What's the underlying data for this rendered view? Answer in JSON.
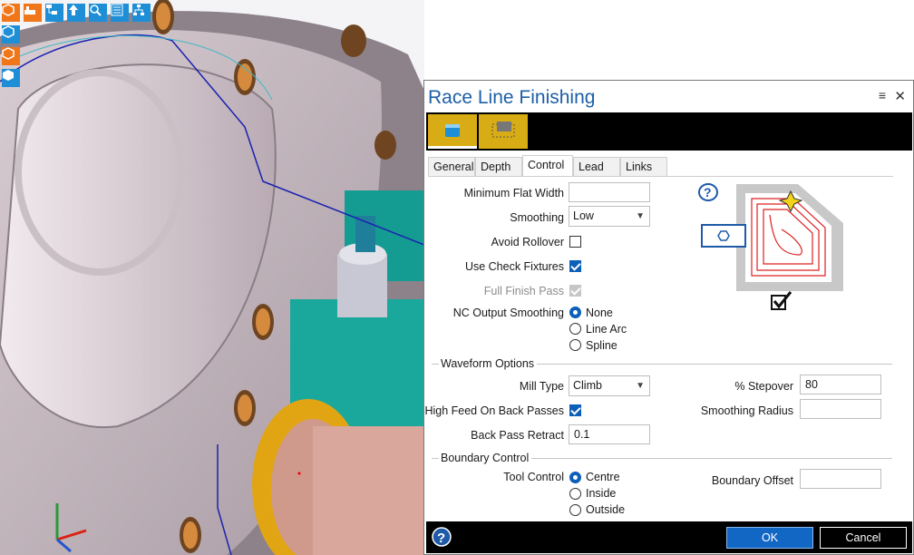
{
  "dialog": {
    "title": "Race Line Finishing",
    "menu_icon": "hamburger-icon",
    "close_icon": "close-icon"
  },
  "tabs": [
    "General",
    "Depth",
    "Control",
    "Lead",
    "Links"
  ],
  "active_tab": "Control",
  "control": {
    "min_flat_width_label": "Minimum Flat Width",
    "min_flat_width_value": "",
    "smoothing_label": "Smoothing",
    "smoothing_value": "Low",
    "avoid_rollover_label": "Avoid Rollover",
    "use_check_fixtures_label": "Use Check Fixtures",
    "full_finish_pass_label": "Full Finish Pass",
    "nc_output_smoothing_label": "NC Output Smoothing",
    "nc_options": [
      "None",
      "Line Arc",
      "Spline"
    ]
  },
  "waveform": {
    "section_label": "Waveform Options",
    "mill_type_label": "Mill Type",
    "mill_type_value": "Climb",
    "high_feed_label": "High Feed On Back Passes",
    "back_pass_retract_label": "Back Pass Retract",
    "back_pass_retract_value": "0.1",
    "stepover_label": "% Stepover",
    "stepover_value": "80",
    "smoothing_radius_label": "Smoothing Radius",
    "smoothing_radius_value": ""
  },
  "boundary": {
    "section_label": "Boundary Control",
    "tool_control_label": "Tool Control",
    "tool_options": [
      "Centre",
      "Inside",
      "Outside"
    ],
    "boundary_offset_label": "Boundary Offset",
    "boundary_offset_value": ""
  },
  "footer": {
    "ok_label": "OK",
    "cancel_label": "Cancel"
  },
  "colors": {
    "accent": "#0d5fb8",
    "strategy_gold": "#d8ac14",
    "title_blue": "#1c5fa6"
  }
}
